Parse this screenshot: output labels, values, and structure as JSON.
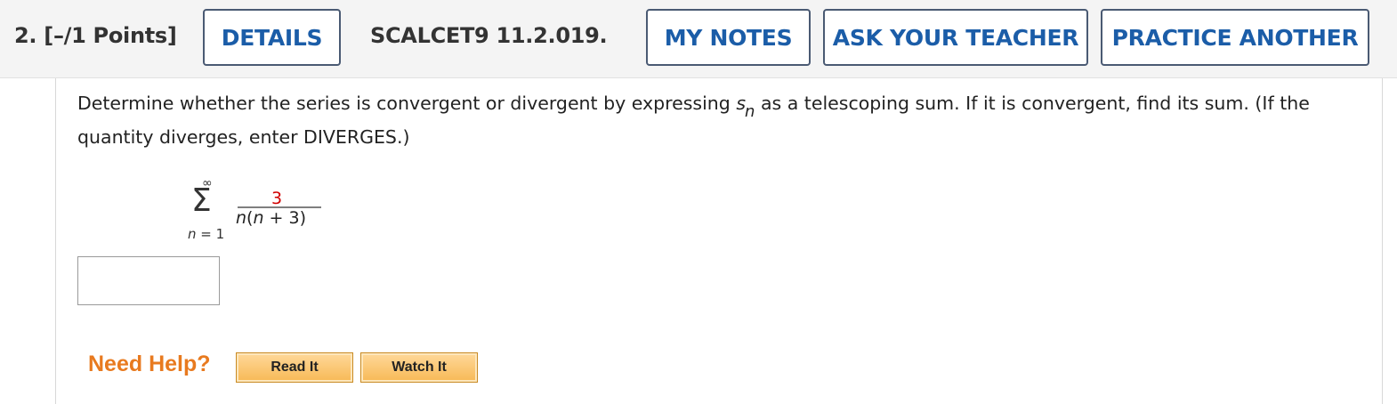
{
  "header": {
    "question_label": "2.  [–/1 Points]",
    "details_button": "DETAILS",
    "course_code": "SCALCET9 11.2.019.",
    "my_notes_button": "MY NOTES",
    "ask_teacher_button": "ASK YOUR TEACHER",
    "practice_button": "PRACTICE ANOTHER"
  },
  "question": {
    "text_before": "Determine whether the series is convergent or divergent by expressing ",
    "s_symbol": "s",
    "s_subscript": "n",
    "text_after": " as a telescoping sum. If it is convergent, find its sum. (If the quantity diverges, enter DIVERGES.)"
  },
  "formula": {
    "sigma": "Σ",
    "upper_limit": "∞",
    "lower_limit_var": "n",
    "lower_limit_rest": " = 1",
    "numerator": "3",
    "denominator_var": "n",
    "denominator_rest": "(",
    "denominator_var2": "n",
    "denominator_tail": " + 3)"
  },
  "answer_input": {
    "value": "",
    "placeholder": ""
  },
  "help": {
    "label": "Need Help?",
    "read_it": "Read It",
    "watch_it": "Watch It"
  },
  "colors": {
    "link_blue": "#1b5da8",
    "help_orange": "#e87a1f",
    "numerator_red": "#d10000"
  }
}
